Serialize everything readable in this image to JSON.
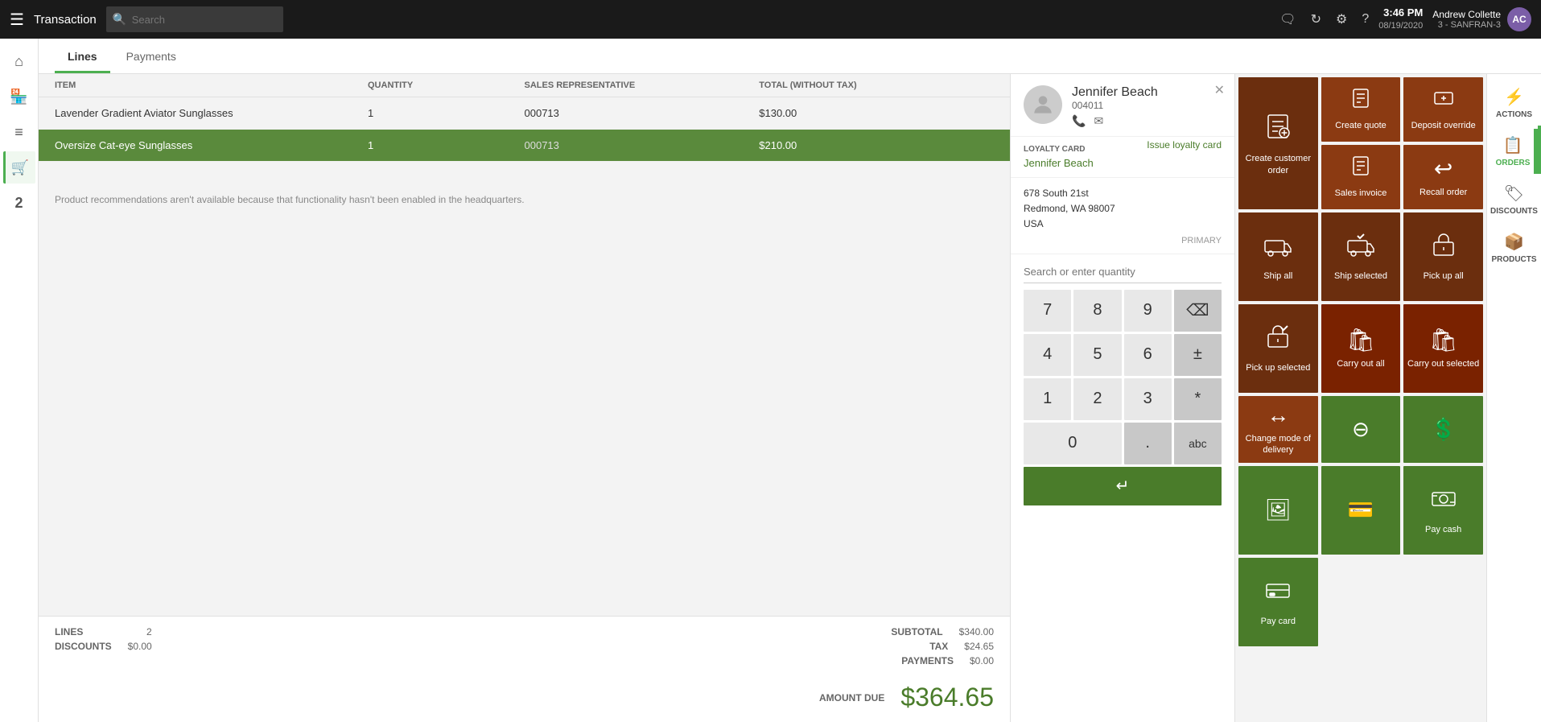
{
  "topbar": {
    "menu_icon": "☰",
    "title": "Transaction",
    "search_placeholder": "Search",
    "time": "3:46 PM",
    "date": "08/19/2020",
    "store": "3 - SANFRAN-3",
    "user_name": "Andrew Collette",
    "user_initials": "AC",
    "icons": [
      "💬",
      "🔄",
      "⚙",
      "?"
    ]
  },
  "tabs": [
    {
      "label": "Lines",
      "active": true
    },
    {
      "label": "Payments",
      "active": false
    }
  ],
  "lines_table": {
    "headers": [
      "ITEM",
      "QUANTITY",
      "SALES REPRESENTATIVE",
      "TOTAL (WITHOUT TAX)"
    ],
    "rows": [
      {
        "item": "Lavender Gradient Aviator Sunglasses",
        "quantity": "1",
        "rep": "000713",
        "total": "$130.00",
        "selected": false
      },
      {
        "item": "Oversize Cat-eye Sunglasses",
        "quantity": "1",
        "rep": "000713",
        "total": "$210.00",
        "selected": true
      }
    ]
  },
  "recommendation_msg": "Product recommendations aren't available because that functionality hasn't been enabled in the headquarters.",
  "footer": {
    "lines_label": "LINES",
    "lines_value": "2",
    "discounts_label": "DISCOUNTS",
    "discounts_value": "$0.00",
    "subtotal_label": "SUBTOTAL",
    "subtotal_value": "$340.00",
    "tax_label": "TAX",
    "tax_value": "$24.65",
    "payments_label": "PAYMENTS",
    "payments_value": "$0.00",
    "amount_due_label": "AMOUNT DUE",
    "amount_due_value": "$364.65"
  },
  "customer": {
    "name": "Jennifer Beach",
    "id": "004011",
    "loyalty_label": "LOYALTY CARD",
    "loyalty_issue": "Issue loyalty card",
    "loyalty_name": "Jennifer Beach",
    "address_line1": "678 South 21st",
    "address_line2": "Redmond, WA 98007",
    "address_line3": "USA",
    "primary_label": "PRIMARY"
  },
  "numpad": {
    "search_placeholder": "Search or enter quantity",
    "buttons": [
      "7",
      "8",
      "9",
      "⌫",
      "4",
      "5",
      "6",
      "±",
      "1",
      "2",
      "3",
      "*",
      "0",
      ".",
      "abc"
    ]
  },
  "action_tiles": [
    {
      "id": "create-customer-order",
      "icon": "📋",
      "label": "Create customer order",
      "color": "brown",
      "span": 1
    },
    {
      "id": "create-quote",
      "icon": "📄",
      "label": "Create quote",
      "color": "brown-sm",
      "span": 1
    },
    {
      "id": "deposit-override",
      "icon": "💰",
      "label": "Deposit override",
      "color": "brown-sm",
      "span": 1
    },
    {
      "id": "sales-invoice",
      "icon": "🧾",
      "label": "Sales invoice",
      "color": "brown-sm",
      "span": 1
    },
    {
      "id": "recall-order",
      "icon": "↩",
      "label": "Recall order",
      "color": "brown-sm",
      "span": 1
    },
    {
      "id": "ship-all",
      "icon": "🚚",
      "label": "Ship all",
      "color": "brown",
      "span": 1
    },
    {
      "id": "ship-selected",
      "icon": "🚛",
      "label": "Ship selected",
      "color": "brown",
      "span": 1
    },
    {
      "id": "pick-up-all",
      "icon": "📦",
      "label": "Pick up all",
      "color": "brown",
      "span": 1
    },
    {
      "id": "pick-up-selected",
      "icon": "🗃",
      "label": "Pick up selected",
      "color": "brown",
      "span": 1
    },
    {
      "id": "carry-out-all",
      "icon": "🛍",
      "label": "Carry out all",
      "color": "dark",
      "span": 1
    },
    {
      "id": "carry-out-selected",
      "icon": "🛍",
      "label": "Carry out selected",
      "color": "dark",
      "span": 1
    },
    {
      "id": "change-mode",
      "icon": "🔄",
      "label": "Change mode of delivery",
      "color": "dark",
      "span": 1
    },
    {
      "id": "icon-btn-1",
      "icon": "⊖",
      "label": "",
      "color": "green",
      "span": 1
    },
    {
      "id": "icon-btn-2",
      "icon": "💲",
      "label": "",
      "color": "green",
      "span": 1
    },
    {
      "id": "icon-btn-3",
      "icon": "🖼",
      "label": "",
      "color": "green",
      "span": 1
    },
    {
      "id": "icon-btn-4",
      "icon": "💳",
      "label": "",
      "color": "green",
      "span": 1
    },
    {
      "id": "pay-cash",
      "icon": "💵",
      "label": "Pay cash",
      "color": "green-large",
      "span": 1
    },
    {
      "id": "pay-card",
      "icon": "💳",
      "label": "Pay card",
      "color": "green-large",
      "span": 1
    }
  ],
  "right_sidebar": [
    {
      "id": "actions",
      "icon": "⚡",
      "label": "ACTIONS",
      "active": false
    },
    {
      "id": "orders",
      "icon": "📋",
      "label": "ORDERS",
      "active": true
    },
    {
      "id": "discounts",
      "icon": "🏷",
      "label": "DISCOUNTS",
      "active": false
    },
    {
      "id": "products",
      "icon": "📦",
      "label": "PRODUCTS",
      "active": false
    }
  ],
  "nav_items": [
    {
      "id": "home",
      "icon": "⌂",
      "active": false
    },
    {
      "id": "store",
      "icon": "🏪",
      "active": false
    },
    {
      "id": "menu",
      "icon": "☰",
      "active": false
    },
    {
      "id": "cart",
      "icon": "🛒",
      "active": true
    },
    {
      "id": "num2",
      "label": "2",
      "active": false
    }
  ]
}
